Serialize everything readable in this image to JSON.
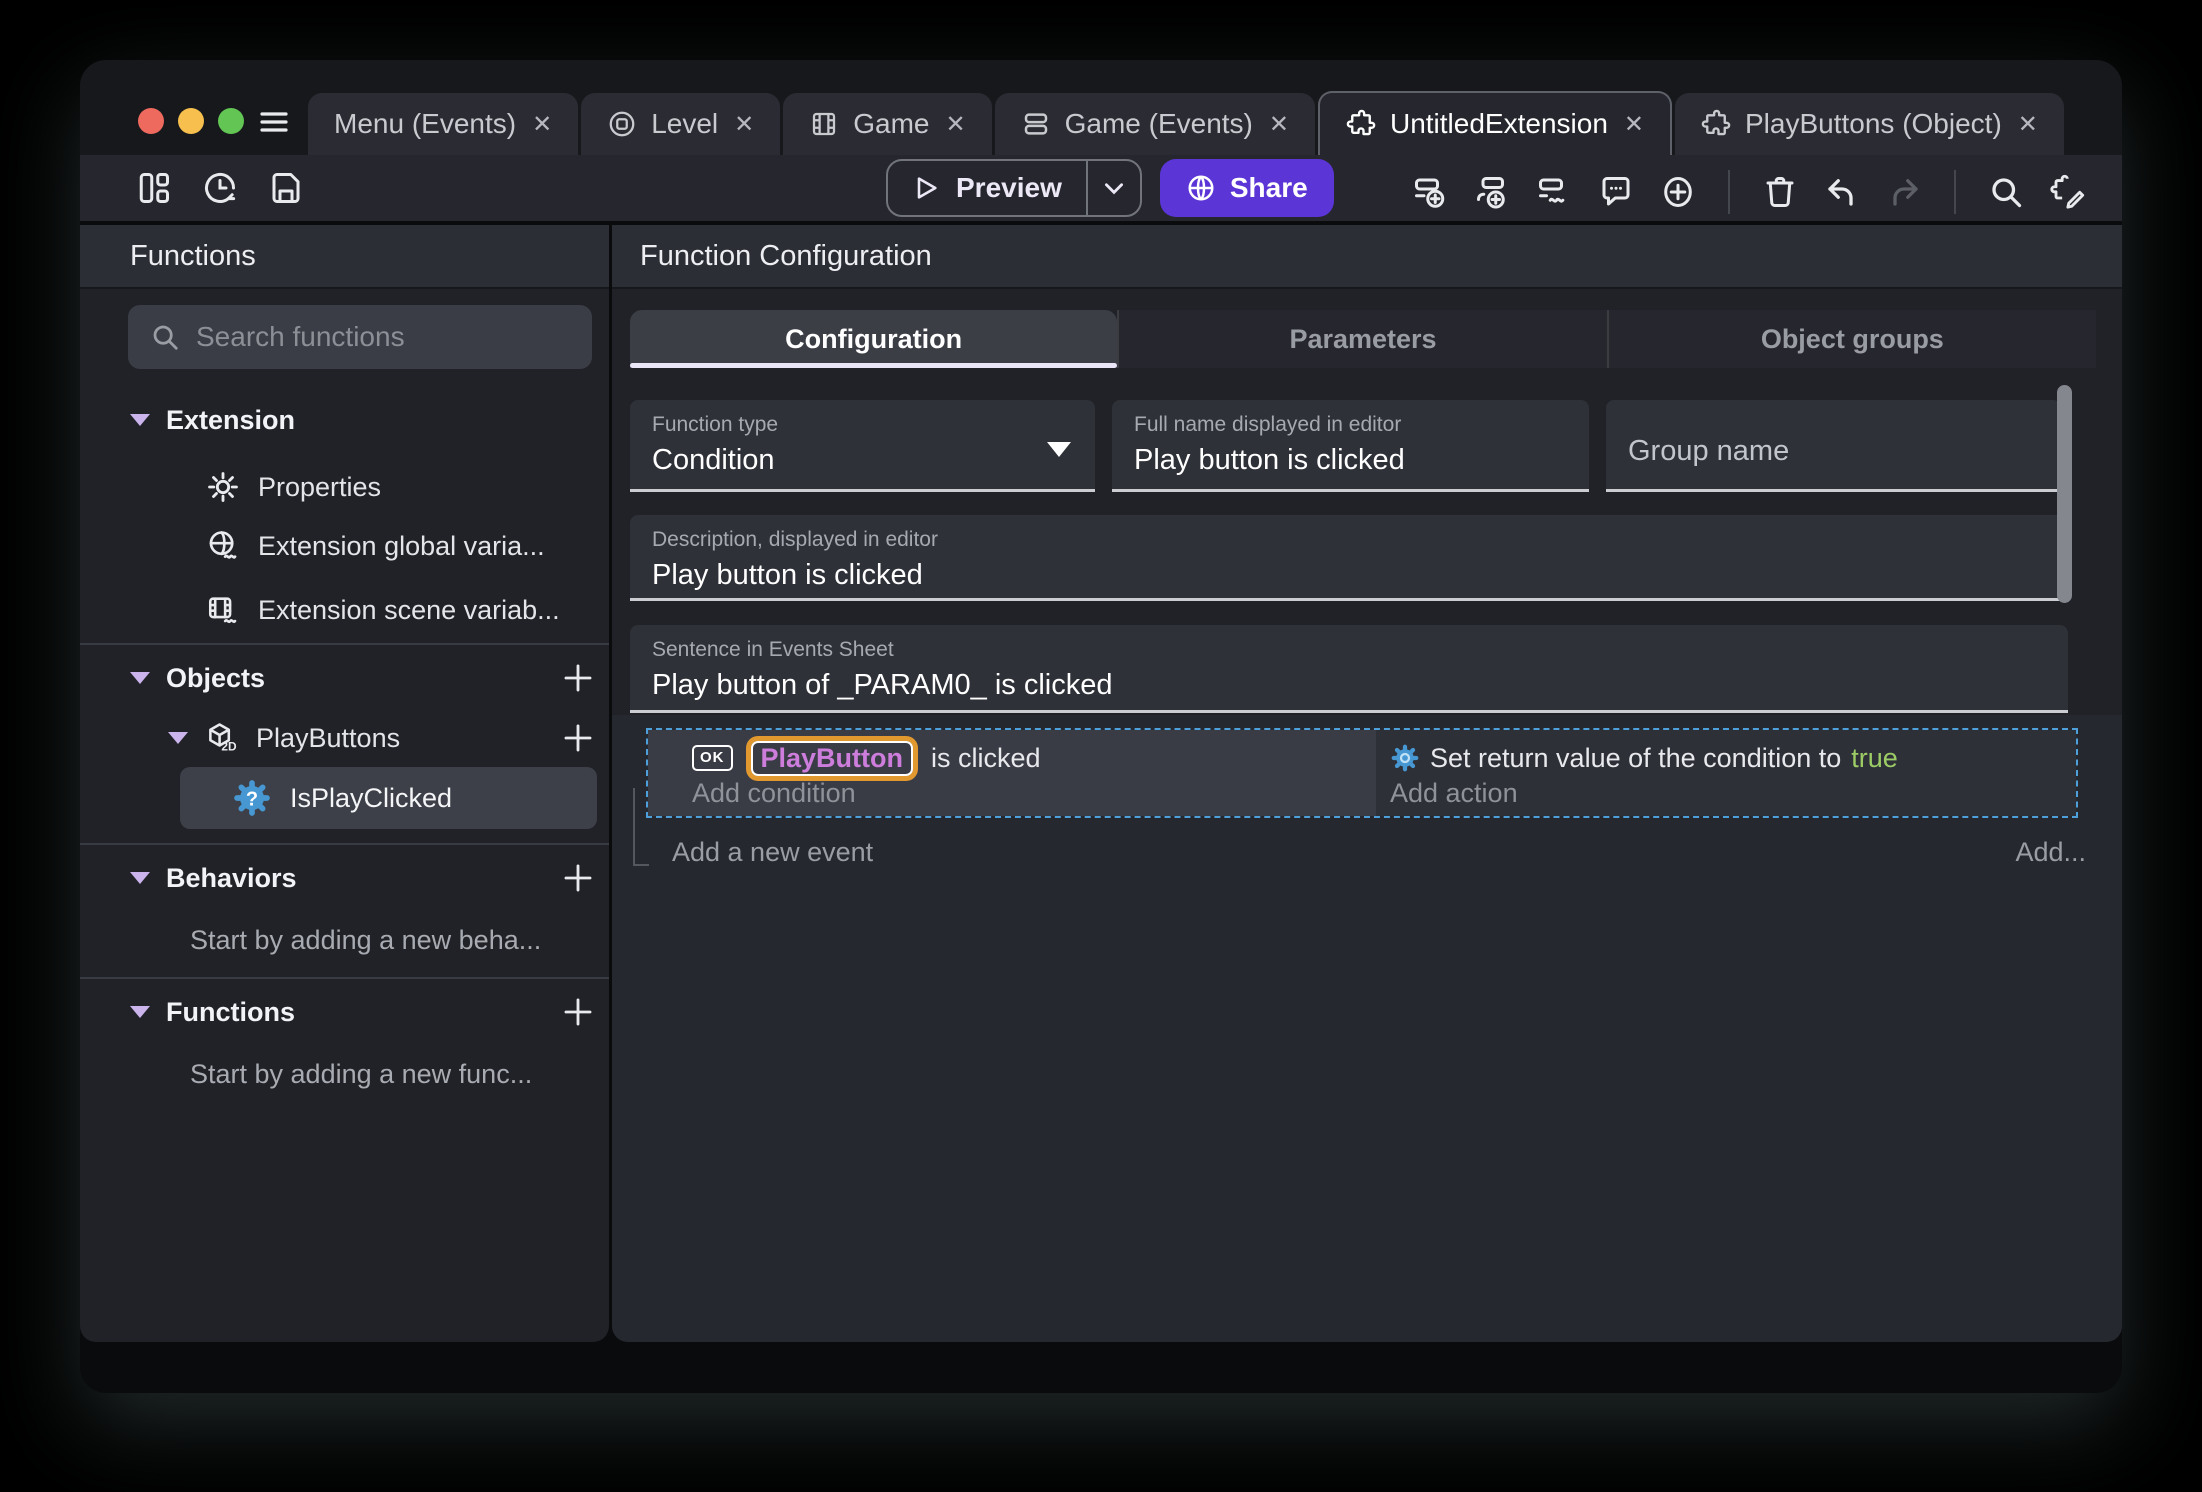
{
  "titlebar": {
    "close_glyph": "✕",
    "tabs": [
      {
        "label": "Menu (Events)"
      },
      {
        "label": "Level"
      },
      {
        "label": "Game"
      },
      {
        "label": "Game (Events)"
      },
      {
        "label": "UntitledExtension"
      },
      {
        "label": "PlayButtons (Object)"
      }
    ]
  },
  "toolbar": {
    "preview_label": "Preview",
    "share_label": "Share"
  },
  "sidebar": {
    "title": "Functions",
    "search_placeholder": "Search functions",
    "extension": {
      "label": "Extension"
    },
    "extension_items": [
      {
        "label": "Properties"
      },
      {
        "label": "Extension global varia..."
      },
      {
        "label": "Extension scene variab..."
      }
    ],
    "objects": {
      "label": "Objects"
    },
    "object_item": {
      "label": "PlayButtons",
      "badge": "2D"
    },
    "function_item": {
      "label": "IsPlayClicked",
      "glyph": "?"
    },
    "behaviors": {
      "label": "Behaviors",
      "empty": "Start by adding a new beha..."
    },
    "functions": {
      "label": "Functions",
      "empty": "Start by adding a new func..."
    }
  },
  "main": {
    "panel_title": "Function Configuration",
    "tabs": [
      {
        "label": "Configuration"
      },
      {
        "label": "Parameters"
      },
      {
        "label": "Object groups"
      }
    ],
    "function_type": {
      "label": "Function type",
      "value": "Condition"
    },
    "full_name": {
      "label": "Full name displayed in editor",
      "value": "Play button is clicked"
    },
    "group_name": {
      "placeholder": "Group name"
    },
    "description": {
      "label": "Description, displayed in editor",
      "value": "Play button is clicked"
    },
    "sentence": {
      "label": "Sentence in Events Sheet",
      "value": "Play button of _PARAM0_ is clicked"
    },
    "events": {
      "condition_object_badge": "OK",
      "condition_object": "PlayButton",
      "condition_text": "is clicked",
      "add_condition": "Add condition",
      "action_text": "Set return value of the condition to",
      "action_value": "true",
      "add_action": "Add action",
      "add_event": "Add a new event",
      "add_more": "Add..."
    }
  },
  "colors": {
    "accent_purple": "#5b35d6",
    "selection_blue": "#4da0d9",
    "object_chip_text": "#cd7ddb",
    "object_chip_outline": "#e0982f",
    "boolean_true_green": "#9ccc65",
    "lavender_accent": "#cbb3ec"
  }
}
